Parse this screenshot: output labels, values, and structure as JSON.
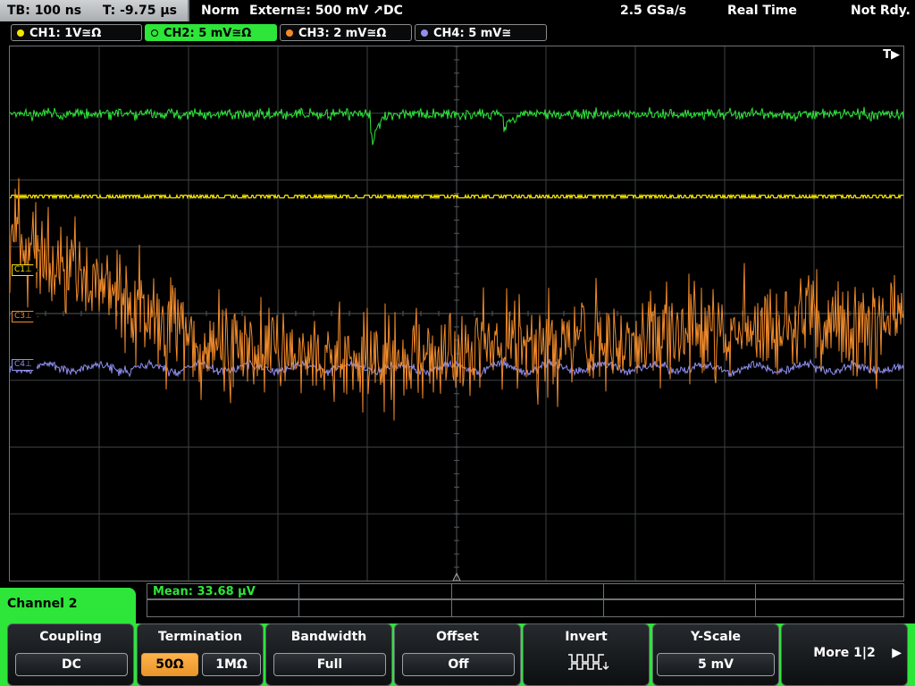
{
  "status": {
    "timebase": "TB: 100 ns",
    "trigger_pos": "T: -9.75 µs",
    "mode": "Norm",
    "trigger": "Extern≅: 500 mV ↗DC",
    "sample_rate": "2.5 GSa/s",
    "acq_mode": "Real Time",
    "state": "Not Rdy."
  },
  "channels": [
    {
      "label": "CH1: 1V≅Ω",
      "color": "#f5e600",
      "active": false
    },
    {
      "label": "CH2: 5 mV≅Ω",
      "color": "#2ee53a",
      "active": true
    },
    {
      "label": "CH3: 2 mV≅Ω",
      "color": "#f08a2a",
      "active": false
    },
    {
      "label": "CH4: 5 mV≅",
      "color": "#8f8ff0",
      "active": false
    }
  ],
  "markers": {
    "trigger": "T▶",
    "ch1": "C1⊥",
    "ch3": "C3⊥",
    "ch4": "C4⊥"
  },
  "measurement": {
    "mean": "Mean: 33.68 µV"
  },
  "panel": {
    "title": "Channel 2"
  },
  "softkeys": {
    "coupling": {
      "title": "Coupling",
      "value": "DC"
    },
    "termination": {
      "title": "Termination",
      "opt1": "50Ω",
      "opt2": "1MΩ",
      "selected": "50Ω"
    },
    "bandwidth": {
      "title": "Bandwidth",
      "value": "Full"
    },
    "offset": {
      "title": "Offset",
      "value": "Off"
    },
    "invert": {
      "title": "Invert"
    },
    "yscale": {
      "title": "Y-Scale",
      "value": "5 mV"
    },
    "more": {
      "label": "More 1|2",
      "arrow": "▶"
    }
  },
  "colors": {
    "accent": "#2ee53a",
    "ch1": "#f5e600",
    "ch2": "#2ee53a",
    "ch3": "#f08a2a",
    "ch4": "#8f8ff0",
    "grid": "#3c3f42"
  }
}
